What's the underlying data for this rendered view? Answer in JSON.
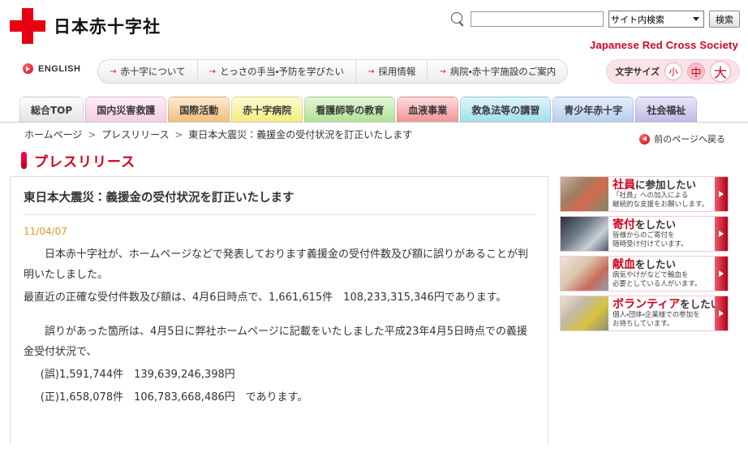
{
  "header": {
    "logo_text": "日本赤十字社",
    "logo_icon": "red-cross-icon",
    "en_name": "Japanese Red Cross Society",
    "search": {
      "icon": "search-icon",
      "input_value": "",
      "placeholder": "",
      "scope_selected": "サイト内検索",
      "button_label": "検索"
    }
  },
  "utilnav": {
    "english_label": "ENGLISH",
    "english_icon": "circle-arrow-right-icon",
    "pills": [
      {
        "label": "赤十字について",
        "arrow": "→"
      },
      {
        "label": "とっさの手当・予防を学びたい",
        "arrow": "→"
      },
      {
        "label": "採用情報",
        "arrow": "→"
      },
      {
        "label": "病院・赤十字施設のご案内",
        "arrow": "→"
      }
    ],
    "fontsize": {
      "label": "文字サイズ",
      "small": "小",
      "medium": "中",
      "large": "大",
      "selected": "中"
    }
  },
  "tabs": [
    {
      "label": "総合TOP",
      "color": "#e9e9e9",
      "active": true
    },
    {
      "label": "国内災害救護",
      "color": "#f7d3e6",
      "active": false
    },
    {
      "label": "国際活動",
      "color": "#f6c98a",
      "active": false
    },
    {
      "label": "赤十字病院",
      "color": "#f7f089",
      "active": false
    },
    {
      "label": "看護師等の教育",
      "color": "#b9e6a0",
      "active": false
    },
    {
      "label": "血液事業",
      "color": "#f39b9b",
      "active": false
    },
    {
      "label": "救急法等の講習",
      "color": "#a8e3ef",
      "active": false
    },
    {
      "label": "青少年赤十字",
      "color": "#bcd3f0",
      "active": false
    },
    {
      "label": "社会福祉",
      "color": "#c4bde8",
      "active": false
    }
  ],
  "breadcrumb": {
    "items": [
      "ホームページ",
      "プレスリリース",
      "東日本大震災：義援金の受付状況を訂正いたします"
    ],
    "separator": ">"
  },
  "back_link": {
    "label": "前のページへ戻る",
    "icon": "circle-arrow-left-icon"
  },
  "page_title": "プレスリリース",
  "article": {
    "title": "東日本大震災：義援金の受付状況を訂正いたします",
    "date": "11/04/07",
    "paragraphs": [
      "　日本赤十字社が、ホームページなどで発表しております義援金の受付件数及び額に誤りがあることが判明いたしました。",
      "最直近の正確な受付件数及び額は、4月6日時点で、1,661,615件　108,233,315,346円であります。",
      "　誤りがあった箇所は、4月5日に弊社ホームページに記載をいたしました平成23年4月5日時点での義援金受付状況で、",
      "(誤)1,591,744件　139,639,246,398円",
      "(正)1,658,078件　106,783,668,486円　であります。"
    ]
  },
  "sidebar": {
    "banners": [
      {
        "keyword": "社員",
        "rest": "に参加したい",
        "sub1": "「社員」への加入による",
        "sub2": "継続的な支援をお願いします。",
        "photo": "volunteers-photo",
        "arrow_icon": "arrow-right-icon"
      },
      {
        "keyword": "寄付",
        "rest": "をしたい",
        "sub1": "皆様からのご寄付を",
        "sub2": "随時受け付けています。",
        "photo": "donation-photo",
        "arrow_icon": "arrow-right-icon"
      },
      {
        "keyword": "献血",
        "rest": "をしたい",
        "sub1": "病気やけがなどで輸血を",
        "sub2": "必要としている人がいます。",
        "photo": "blood-donation-photo",
        "arrow_icon": "arrow-right-icon"
      },
      {
        "keyword": "ボランティア",
        "rest": "をしたい",
        "sub1": "個人・団体・企業様での参加を",
        "sub2": "お待ちしています。",
        "photo": "volunteer-activity-photo",
        "arrow_icon": "arrow-right-icon"
      }
    ]
  },
  "colors": {
    "brand_red": "#e50012",
    "accent_red": "#d4001b",
    "date_orange": "#e8922c"
  }
}
